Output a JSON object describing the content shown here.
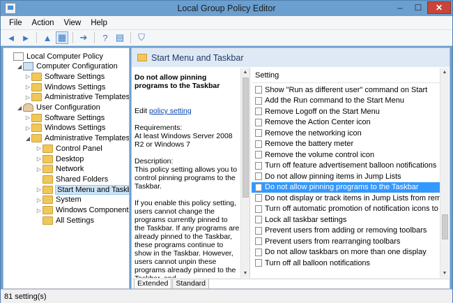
{
  "window": {
    "title": "Local Group Policy Editor",
    "minimize": "–",
    "maximize": "☐",
    "close": "✕"
  },
  "menu": [
    "File",
    "Action",
    "View",
    "Help"
  ],
  "toolbar": {
    "back": "◄",
    "forward": "►",
    "up": "▲",
    "show_tree": "▦",
    "export": "➔",
    "help": "?",
    "properties": "▤",
    "filter": "⛉"
  },
  "tree": [
    {
      "label": "Local Computer Policy",
      "exp": "",
      "icon": "pol",
      "level": 0
    },
    {
      "label": "Computer Configuration",
      "exp": "◢",
      "icon": "pc",
      "level": 1
    },
    {
      "label": "Software Settings",
      "exp": "▷",
      "icon": "folder",
      "level": 2
    },
    {
      "label": "Windows Settings",
      "exp": "▷",
      "icon": "folder",
      "level": 2
    },
    {
      "label": "Administrative Templates",
      "exp": "▷",
      "icon": "folder",
      "level": 2
    },
    {
      "label": "User Configuration",
      "exp": "◢",
      "icon": "usr",
      "level": 1
    },
    {
      "label": "Software Settings",
      "exp": "▷",
      "icon": "folder",
      "level": 2
    },
    {
      "label": "Windows Settings",
      "exp": "▷",
      "icon": "folder",
      "level": 2
    },
    {
      "label": "Administrative Templates",
      "exp": "◢",
      "icon": "folder",
      "level": 2
    },
    {
      "label": "Control Panel",
      "exp": "▷",
      "icon": "folder",
      "level": 3
    },
    {
      "label": "Desktop",
      "exp": "▷",
      "icon": "folder",
      "level": 3
    },
    {
      "label": "Network",
      "exp": "▷",
      "icon": "folder",
      "level": 3
    },
    {
      "label": "Shared Folders",
      "exp": "",
      "icon": "folder",
      "level": 3
    },
    {
      "label": "Start Menu and Taskbar",
      "exp": "▷",
      "icon": "folder",
      "level": 3,
      "selected": true
    },
    {
      "label": "System",
      "exp": "▷",
      "icon": "folder",
      "level": 3
    },
    {
      "label": "Windows Components",
      "exp": "▷",
      "icon": "folder",
      "level": 3
    },
    {
      "label": "All Settings",
      "exp": "",
      "icon": "folder",
      "level": 3
    }
  ],
  "header": {
    "title": "Start Menu and Taskbar"
  },
  "description": {
    "policy_title": "Do not allow pinning programs to the Taskbar",
    "edit_prefix": "Edit ",
    "edit_link": "policy setting",
    "requirements_label": "Requirements:",
    "requirements": "At least Windows Server 2008 R2 or Windows 7",
    "description_label": "Description:",
    "description": "This policy setting allows you to control pinning programs to the Taskbar.",
    "details": "If you enable this policy setting, users cannot change the programs currently pinned to the Taskbar. If any programs are already pinned to the Taskbar, these programs continue to show in the Taskbar. However, users cannot unpin these programs already pinned to the Taskbar, and"
  },
  "list": {
    "column": "Setting",
    "rows": [
      {
        "label": "Show \"Run as different user\" command on Start"
      },
      {
        "label": "Add the Run command to the Start Menu"
      },
      {
        "label": "Remove Logoff on the Start Menu"
      },
      {
        "label": "Remove the Action Center icon"
      },
      {
        "label": "Remove the networking icon"
      },
      {
        "label": "Remove the battery meter"
      },
      {
        "label": "Remove the volume control icon"
      },
      {
        "label": "Turn off feature advertisement balloon notifications"
      },
      {
        "label": "Do not allow pinning items in Jump Lists"
      },
      {
        "label": "Do not allow pinning programs to the Taskbar",
        "selected": true
      },
      {
        "label": "Do not display or track items in Jump Lists from remote locations"
      },
      {
        "label": "Turn off automatic promotion of notification icons to the taskbar"
      },
      {
        "label": "Lock all taskbar settings"
      },
      {
        "label": "Prevent users from adding or removing toolbars"
      },
      {
        "label": "Prevent users from rearranging toolbars"
      },
      {
        "label": "Do not allow taskbars on more than one display"
      },
      {
        "label": "Turn off all balloon notifications"
      }
    ]
  },
  "tabs": [
    "Extended",
    "Standard"
  ],
  "status": "81 setting(s)",
  "colors": {
    "title_bar": "#6a9fd0",
    "selection": "#3399ff",
    "close_button": "#c7453b"
  }
}
